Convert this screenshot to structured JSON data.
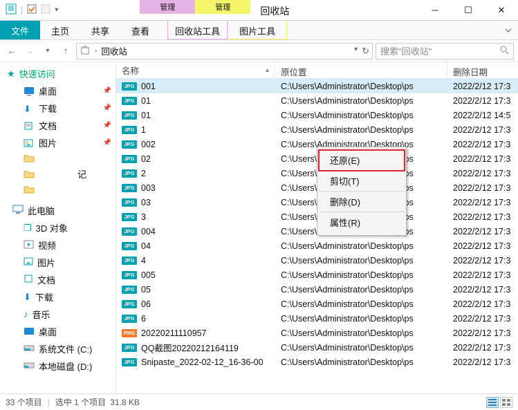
{
  "window": {
    "title": "回收站"
  },
  "tabgroups": [
    {
      "caption": "管理",
      "tab": "回收站工具"
    },
    {
      "caption": "管理",
      "tab": "图片工具"
    }
  ],
  "ribbon": {
    "file": "文件",
    "tabs": [
      "主页",
      "共享",
      "查看"
    ]
  },
  "crumb": {
    "root": "回收站"
  },
  "search": {
    "placeholder": "搜索\"回收站\""
  },
  "nav": {
    "quick": "快速访问",
    "desktop": "桌面",
    "downloads": "下载",
    "documents": "文档",
    "pictures": "图片",
    "notes": "记",
    "thispc": "此电脑",
    "obj3d": "3D 对象",
    "videos": "视频",
    "pictures2": "图片",
    "documents2": "文档",
    "downloads2": "下载",
    "music": "音乐",
    "desktop2": "桌面",
    "sysdrive": "系统文件 (C:)",
    "localdisk": "本地磁盘 (D:)"
  },
  "columns": {
    "name": "名称",
    "path": "原位置",
    "date": "删除日期"
  },
  "files": [
    {
      "type": "jpg",
      "name": "001",
      "path": "C:\\Users\\Administrator\\Desktop\\ps",
      "date": "2022/2/12 17:3"
    },
    {
      "type": "jpg",
      "name": "01",
      "path": "C:\\Users\\Administrator\\Desktop\\ps",
      "date": "2022/2/12 17:3"
    },
    {
      "type": "jpg",
      "name": "01",
      "path": "C:\\Users\\Administrator\\Desktop\\ps",
      "date": "2022/2/12 14:5"
    },
    {
      "type": "jpg",
      "name": "1",
      "path": "C:\\Users\\Administrator\\Desktop\\ps",
      "date": "2022/2/12 17:3"
    },
    {
      "type": "jpg",
      "name": "002",
      "path": "C:\\Users\\Administrator\\Desktop\\ps",
      "date": "2022/2/12 17:3"
    },
    {
      "type": "jpg",
      "name": "02",
      "path": "C:\\Users\\Administrator\\Desktop\\ps",
      "date": "2022/2/12 17:3"
    },
    {
      "type": "jpg",
      "name": "2",
      "path": "C:\\Users\\Administrator\\Desktop\\ps",
      "date": "2022/2/12 17:3"
    },
    {
      "type": "jpg",
      "name": "003",
      "path": "C:\\Users\\Administrator\\Desktop\\ps",
      "date": "2022/2/12 17:3"
    },
    {
      "type": "jpg",
      "name": "03",
      "path": "C:\\Users\\Administrator\\Desktop\\ps",
      "date": "2022/2/12 17:3"
    },
    {
      "type": "jpg",
      "name": "3",
      "path": "C:\\Users\\Administrator\\Desktop\\ps",
      "date": "2022/2/12 17:3"
    },
    {
      "type": "jpg",
      "name": "004",
      "path": "C:\\Users\\Administrator\\Desktop\\ps",
      "date": "2022/2/12 17:3"
    },
    {
      "type": "jpg",
      "name": "04",
      "path": "C:\\Users\\Administrator\\Desktop\\ps",
      "date": "2022/2/12 17:3"
    },
    {
      "type": "jpg",
      "name": "4",
      "path": "C:\\Users\\Administrator\\Desktop\\ps",
      "date": "2022/2/12 17:3"
    },
    {
      "type": "jpg",
      "name": "005",
      "path": "C:\\Users\\Administrator\\Desktop\\ps",
      "date": "2022/2/12 17:3"
    },
    {
      "type": "jpg",
      "name": "05",
      "path": "C:\\Users\\Administrator\\Desktop\\ps",
      "date": "2022/2/12 17:3"
    },
    {
      "type": "jpg",
      "name": "06",
      "path": "C:\\Users\\Administrator\\Desktop\\ps",
      "date": "2022/2/12 17:3"
    },
    {
      "type": "jpg",
      "name": "6",
      "path": "C:\\Users\\Administrator\\Desktop\\ps",
      "date": "2022/2/12 17:3"
    },
    {
      "type": "png",
      "name": "20220211110957",
      "path": "C:\\Users\\Administrator\\Desktop\\ps",
      "date": "2022/2/12 17:3"
    },
    {
      "type": "jpg",
      "name": "QQ截图20220212164119",
      "path": "C:\\Users\\Administrator\\Desktop\\ps",
      "date": "2022/2/12 17:3"
    },
    {
      "type": "jpg",
      "name": "Snipaste_2022-02-12_16-36-00",
      "path": "C:\\Users\\Administrator\\Desktop\\ps",
      "date": "2022/2/12 17:3"
    }
  ],
  "contextmenu": {
    "restore": "还原(E)",
    "cut": "剪切(T)",
    "delete": "删除(D)",
    "properties": "属性(R)"
  },
  "status": {
    "total": "33 个项目",
    "selected": "选中 1 个项目",
    "size": "31.8 KB"
  }
}
